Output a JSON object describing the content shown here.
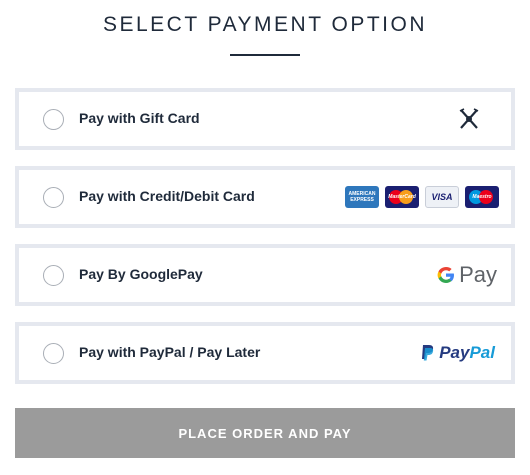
{
  "title": "SELECT PAYMENT OPTION",
  "options": [
    {
      "label": "Pay with Gift Card",
      "icon": "gift-card-icon"
    },
    {
      "label": "Pay with Credit/Debit Card",
      "cards": [
        "AMERICAN EXPRESS",
        "MasterCard",
        "VISA",
        "Maestro"
      ]
    },
    {
      "label": "Pay By GooglePay",
      "logo_text": "Pay"
    },
    {
      "label": "Pay with PayPal / Pay Later",
      "logo_text_1": "Pay",
      "logo_text_2": "Pal"
    }
  ],
  "place_order_label": "PLACE ORDER AND PAY",
  "colors": {
    "accent": "#1f2a3a",
    "border": "#e5e8ef",
    "button": "#9b9b9b"
  }
}
